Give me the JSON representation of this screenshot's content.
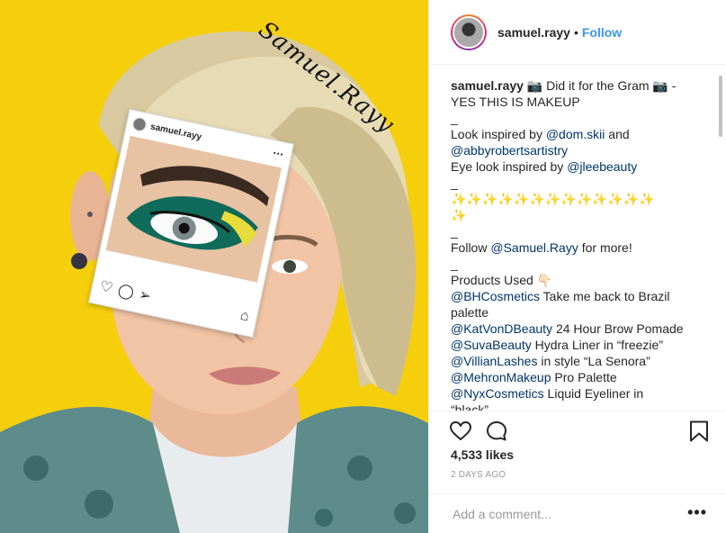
{
  "post": {
    "username": "samuel.rayy",
    "separator": "•",
    "follow_label": "Follow",
    "photo": {
      "signature": "Samuel.Rayy",
      "mini_post_username": "samuel.rayy"
    },
    "caption": {
      "username": "samuel.rayy",
      "text_1": " 📷 Did it for the Gram 📷 -",
      "text_2": "YES THIS IS MAKEUP",
      "underscore": "_",
      "look_prefix": "Look inspired by ",
      "mention_domskii": "@dom.skii",
      "and_text": " and",
      "mention_abby": "@abbyrobertsartistry",
      "eye_prefix": "Eye look inspired by ",
      "mention_jlee": "@jleebeauty",
      "sparkles_line1": "✨✨✨✨✨✨✨✨✨✨✨✨✨",
      "sparkles_line2": "✨",
      "follow_prefix": "Follow ",
      "mention_samuel": "@Samuel.Rayy",
      "follow_suffix": " for more!",
      "products_label": "Products Used 👇🏻",
      "products": [
        {
          "mention": "@BHCosmetics",
          "text": " Take me back to Brazil"
        },
        {
          "mention": "",
          "text": "palette"
        },
        {
          "mention": "@KatVonDBeauty",
          "text": " 24 Hour Brow Pomade"
        },
        {
          "mention": "@SuvaBeauty",
          "text": " Hydra Liner in “freezie”"
        },
        {
          "mention": "@VillianLashes",
          "text": " in style “La Senora”"
        },
        {
          "mention": "@MehronMakeup",
          "text": " Pro Palette"
        },
        {
          "mention": "@NyxCosmetics",
          "text": " Liquid Eyeliner in"
        },
        {
          "mention": "",
          "text": "“black”"
        }
      ]
    },
    "likes": "4,533 likes",
    "time": "2 DAYS AGO",
    "add_comment_placeholder": "Add a comment...",
    "more_label": "•••",
    "icons": {
      "like": "heart-icon",
      "comment": "comment-icon",
      "save": "bookmark-icon"
    },
    "colors": {
      "link": "#003569",
      "follow": "#3897f0",
      "background_yellow": "#f5cf0c"
    }
  }
}
